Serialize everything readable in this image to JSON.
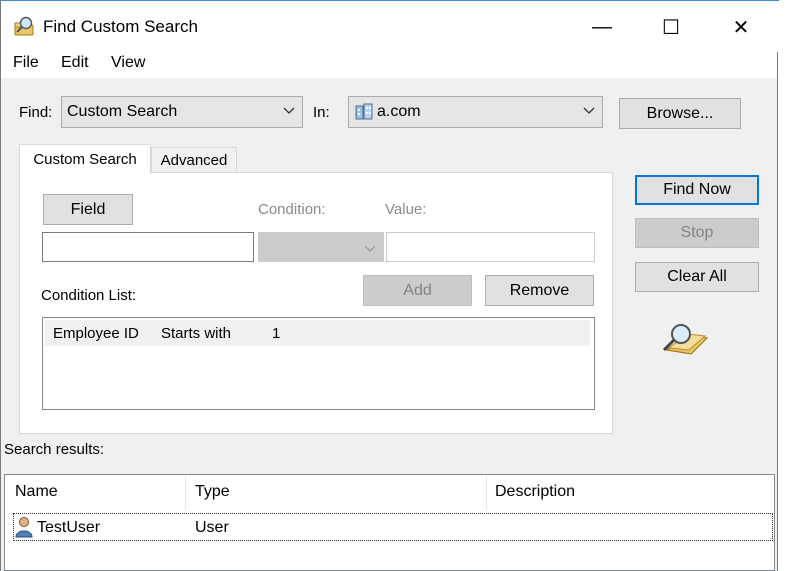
{
  "window": {
    "title": "Find Custom Search",
    "minimize_glyph": "—",
    "maximize_glyph": "☐",
    "close_glyph": "✕"
  },
  "menu": {
    "items": [
      "File",
      "Edit",
      "View"
    ]
  },
  "find": {
    "label": "Find:",
    "value": "Custom Search",
    "in_label": "In:",
    "in_value": "a.com",
    "browse_label": "Browse..."
  },
  "tabs": [
    {
      "label": "Custom Search",
      "selected": true
    },
    {
      "label": "Advanced",
      "selected": false
    }
  ],
  "custom": {
    "field_button": "Field",
    "condition_label": "Condition:",
    "value_label": "Value:",
    "condition_list_label": "Condition List:",
    "add_button": "Add",
    "remove_button": "Remove",
    "conditions": [
      {
        "field": "Employee ID",
        "condition": "Starts with",
        "value": "1"
      }
    ]
  },
  "actions": {
    "find_now": "Find Now",
    "stop": "Stop",
    "clear_all": "Clear All"
  },
  "results": {
    "label": "Search results:",
    "columns": [
      "Name",
      "Type",
      "Description"
    ],
    "rows": [
      {
        "name": "TestUser",
        "type": "User",
        "description": ""
      }
    ]
  },
  "icons": {
    "title": "find-search-icon",
    "domain": "domain-icon",
    "search_animation": "magnifier-folder-icon",
    "user": "user-icon"
  },
  "colors": {
    "accent": "#0078d7",
    "face": "#f0f0f0",
    "selection": "#f0f0f0"
  }
}
